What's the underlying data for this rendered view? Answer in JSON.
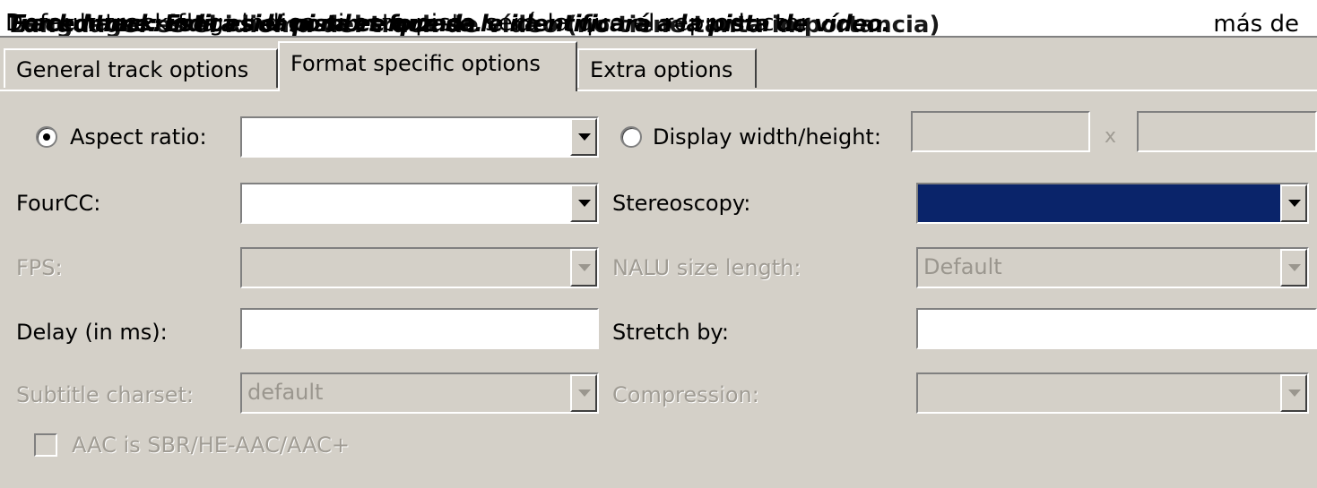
{
  "header_text": {
    "line1": "Track name: Esta es el nombre que se le identificará a la pista de vídeo.",
    "line2": "Language: es el idioma del track de vídeo (no tiene tanta importancia)",
    "line3": "Default track flag: indica si esta pista será la que el reproductor",
    "line4": "Forced track: indica si la pista es forzada.",
    "tail": "más de"
  },
  "tabs": [
    {
      "label": "General track options",
      "active": false
    },
    {
      "label": "Format specific options",
      "active": true
    },
    {
      "label": "Extra options",
      "active": false
    }
  ],
  "form": {
    "aspect_ratio": {
      "label": "Aspect ratio:",
      "value": "",
      "selected": true
    },
    "display_wh": {
      "label": "Display width/height:",
      "width": "",
      "height": "",
      "separator": "x",
      "selected": false
    },
    "fourcc": {
      "label": "FourCC:",
      "value": ""
    },
    "stereoscopy": {
      "label": "Stereoscopy:",
      "value": ""
    },
    "fps": {
      "label": "FPS:",
      "value": ""
    },
    "nalu": {
      "label": "NALU size length:",
      "value": "Default"
    },
    "delay": {
      "label": "Delay (in ms):",
      "value": ""
    },
    "stretch": {
      "label": "Stretch by:",
      "value": ""
    },
    "subtitle_charset": {
      "label": "Subtitle charset:",
      "value": "default"
    },
    "compression": {
      "label": "Compression:",
      "value": ""
    },
    "aac_sbr": {
      "label": "AAC is SBR/HE-AAC/AAC+",
      "checked": false
    }
  },
  "colors": {
    "selection": "#0a246a",
    "face": "#d4d0c8"
  }
}
